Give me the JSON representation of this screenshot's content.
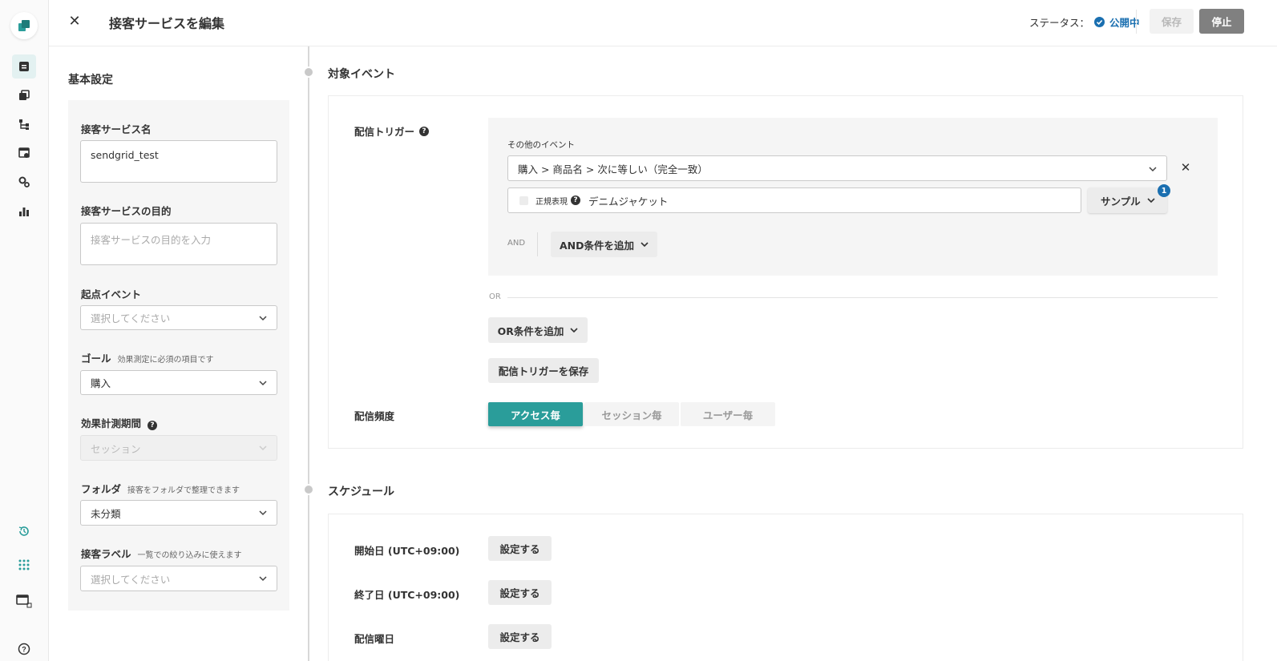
{
  "header": {
    "title": "接客サービスを編集",
    "status_label": "ステータス：",
    "status_value": "公開中",
    "save_label": "保存",
    "stop_label": "停止"
  },
  "basic_settings": {
    "title": "基本設定",
    "name_label": "接客サービス名",
    "name_value": "sendgrid_test",
    "purpose_label": "接客サービスの目的",
    "purpose_placeholder": "接客サービスの目的を入力",
    "origin_event_label": "起点イベント",
    "origin_event_placeholder": "選択してください",
    "goal_label": "ゴール",
    "goal_hint": "効果測定に必須の項目です",
    "goal_value": "購入",
    "period_label": "効果計測期間",
    "period_value": "セッション",
    "folder_label": "フォルダ",
    "folder_hint": "接客をフォルダで整理できます",
    "folder_value": "未分類",
    "label_label": "接客ラベル",
    "label_hint": "一覧での絞り込みに使えます",
    "label_placeholder": "選択してください"
  },
  "target_event": {
    "title": "対象イベント",
    "trigger_label": "配信トリガー",
    "other_event_label": "その他のイベント",
    "event_condition": "購入 > 商品名 > 次に等しい（完全一致）",
    "regex_label": "正規表現",
    "condition_value": "デニムジャケット",
    "sample_label": "サンプル",
    "sample_badge": "1",
    "and_label": "AND",
    "add_and_label": "AND条件を追加",
    "or_label": "OR",
    "add_or_label": "OR条件を追加",
    "save_trigger_label": "配信トリガーを保存",
    "frequency_label": "配信頻度",
    "frequency_options": [
      "アクセス毎",
      "セッション毎",
      "ユーザー毎"
    ],
    "frequency_selected": "アクセス毎"
  },
  "schedule": {
    "title": "スケジュール",
    "start_label": "開始日 (UTC+09:00)",
    "end_label": "終了日 (UTC+09:00)",
    "weekday_label": "配信曜日",
    "set_label": "設定する"
  },
  "colors": {
    "accent": "#2a9d9a",
    "status_blue": "#1a6fb0",
    "stop_button": "#808080"
  },
  "icons": [
    "logo-icon",
    "campaign-icon",
    "copy-icon",
    "flow-icon",
    "data-icon",
    "settings-icon",
    "analytics-icon",
    "history-icon",
    "apps-icon",
    "window-icon",
    "help-icon"
  ]
}
